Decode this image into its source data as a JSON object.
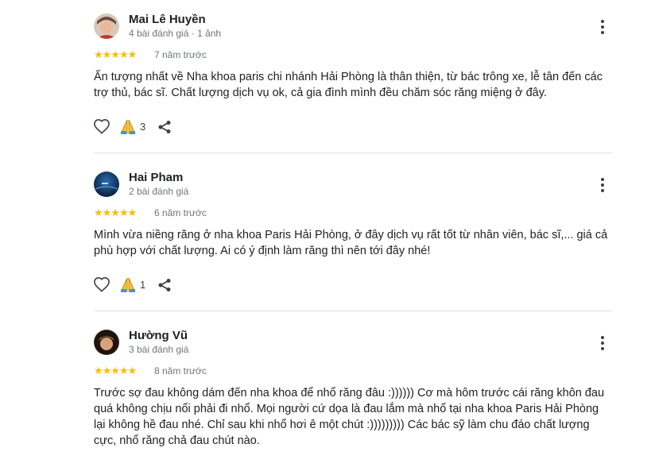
{
  "reviews": [
    {
      "author": "Mai Lê Huyền",
      "meta": "4 bài đánh giá · 1 ảnh",
      "stars": "★★★★★",
      "time": "7 năm trước",
      "text": "Ấn tượng nhất về Nha khoa paris chi nhánh Hải Phòng là thân thiện, từ bác trông xe, lễ tân đến các trợ thủ, bác sĩ. Chất lượng dịch vụ ok, cả gia đình mình đều chăm sóc răng miệng ở đây.",
      "reactions": "3"
    },
    {
      "author": "Hai Pham",
      "meta": "2 bài đánh giá",
      "stars": "★★★★★",
      "time": "6 năm trước",
      "text": "Mình vừa niềng răng ở nha khoa Paris Hải Phòng, ở đây dịch vụ rất tốt từ nhân viên, bác sĩ,... giá cả phù hợp với chất lượng. Ai có ý định làm răng thì nên tới đây nhé!",
      "reactions": "1"
    },
    {
      "author": "Hường Vũ",
      "meta": "3 bài đánh giá",
      "stars": "★★★★★",
      "time": "8 năm trước",
      "text": "Trước sợ đau không dám đến nha khoa để nhổ răng đâu :)))))) Cơ mà hôm trước cái răng khôn đau quá không chịu nổi phải đi nhổ. Mọi người cứ dọa là đau lắm mà nhổ tại nha khoa Paris Hải Phòng lại không hề đau nhé. Chỉ sau khi nhổ hơi ê một chút :))))))))) Các bác sỹ làm chu đáo chất lượng cực, nhổ răng chả đau chút nào."
    }
  ],
  "colors": {
    "star": "#fbbc04",
    "text": "#202124",
    "muted": "#70757a",
    "divider": "#e0e0e0"
  },
  "icons": {
    "like": "heart-outline-icon",
    "react": "folded-hands-icon",
    "share": "share-icon",
    "more": "more-vert-icon"
  }
}
